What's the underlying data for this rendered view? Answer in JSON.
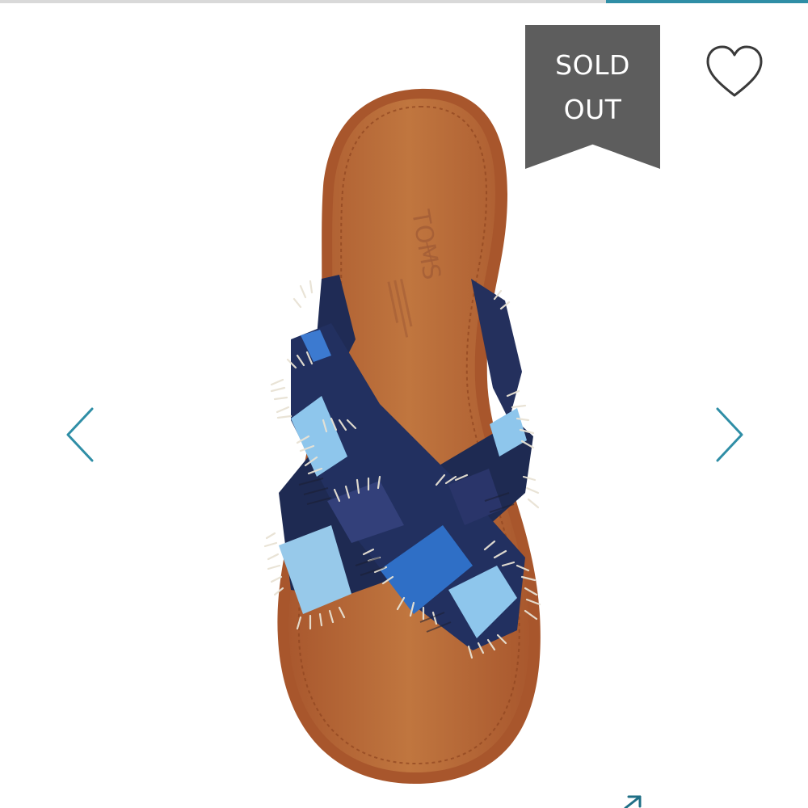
{
  "carousel": {
    "active_slide_indicator": "slide-4-of-4"
  },
  "product_image": {
    "brand_mark": "TOMS",
    "colors": {
      "footbed": "#b86a3a",
      "sole_edge": "#a7542a",
      "strap_navy": "#1f2b55",
      "strap_light_blue": "#8ec6ec",
      "strap_mid_blue": "#2f6fc6",
      "fringe": "#e8e2d4"
    }
  },
  "badge": {
    "label": "SOLD\nOUT",
    "color": "#5d5d5d"
  },
  "actions": {
    "favorite_icon": "heart-outline-icon",
    "prev_icon": "chevron-left-icon",
    "next_icon": "chevron-right-icon",
    "expand_icon": "arrow-up-right-icon"
  },
  "theme": {
    "accent": "#2f8ea6",
    "divider": "#d9d9d9"
  }
}
